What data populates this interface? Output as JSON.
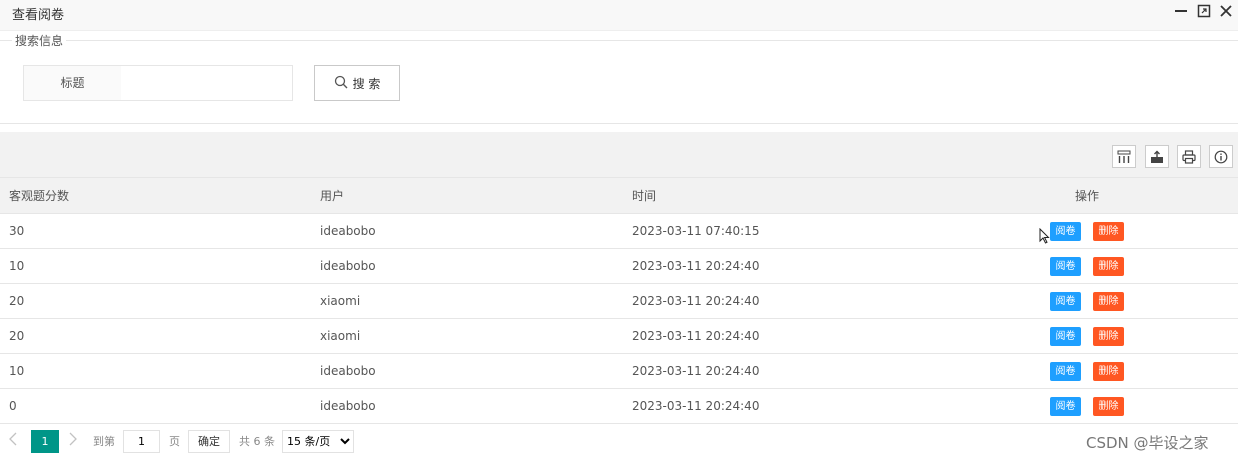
{
  "window": {
    "title": "查看阅卷",
    "min_icon": "minimize-icon",
    "max_icon": "maximize-icon",
    "close_icon": "close-icon"
  },
  "search": {
    "legend": "搜索信息",
    "field_label": "标题",
    "field_value": "",
    "button_label": "搜 索"
  },
  "toolbar": {
    "icons": [
      "columns-icon",
      "export-icon",
      "print-icon",
      "info-icon"
    ]
  },
  "table": {
    "columns": [
      "客观题分数",
      "用户",
      "时间",
      "操作"
    ],
    "rows": [
      {
        "score": "30",
        "user": "ideabobo",
        "time": "2023-03-11 07:40:15"
      },
      {
        "score": "10",
        "user": "ideabobo",
        "time": "2023-03-11 20:24:40"
      },
      {
        "score": "20",
        "user": "xiaomi",
        "time": "2023-03-11 20:24:40"
      },
      {
        "score": "20",
        "user": "xiaomi",
        "time": "2023-03-11 20:24:40"
      },
      {
        "score": "10",
        "user": "ideabobo",
        "time": "2023-03-11 20:24:40"
      },
      {
        "score": "0",
        "user": "ideabobo",
        "time": "2023-03-11 20:24:40"
      }
    ],
    "view_label": "阅卷",
    "delete_label": "删除"
  },
  "pager": {
    "current_page": "1",
    "goto_label": "到第",
    "goto_value": "1",
    "page_unit": "页",
    "confirm_label": "确定",
    "total_label": "共 6 条",
    "page_size": "15 条/页"
  },
  "watermark": "CSDN @毕设之家",
  "colors": {
    "primary": "#1e9fff",
    "danger": "#ff5722",
    "page_active": "#009688"
  }
}
